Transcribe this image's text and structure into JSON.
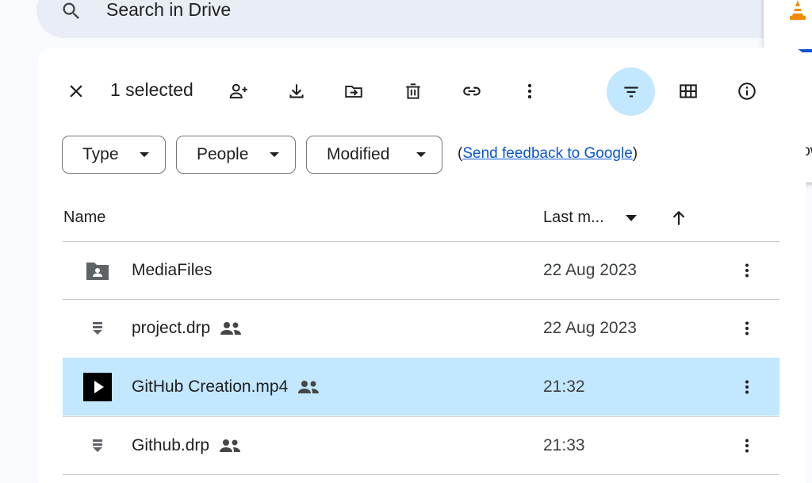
{
  "search": {
    "placeholder": "Search in Drive"
  },
  "toolbar": {
    "selected_text": "1 selected"
  },
  "filters": {
    "type_label": "Type",
    "people_label": "People",
    "modified_label": "Modified",
    "feedback_prefix": "(",
    "feedback_link": "Send feedback to Google",
    "feedback_suffix": ")"
  },
  "table": {
    "headers": {
      "name": "Name",
      "last_modified": "Last m..."
    },
    "rows": [
      {
        "name": "MediaFiles",
        "date": "22 Aug 2023",
        "type": "shared-folder",
        "shared": false,
        "selected": false
      },
      {
        "name": "project.drp",
        "date": "22 Aug 2023",
        "type": "generic-file",
        "shared": true,
        "selected": false
      },
      {
        "name": "GitHub Creation.mp4",
        "date": "21:32",
        "type": "video",
        "shared": true,
        "selected": true
      },
      {
        "name": "Github.drp",
        "date": "21:33",
        "type": "generic-file",
        "shared": true,
        "selected": false
      }
    ]
  },
  "side_popup": {
    "text": "Show"
  },
  "colors": {
    "accent": "#0b57d0",
    "selected_row": "#c2e7ff",
    "search_bg": "#e9eef6"
  }
}
